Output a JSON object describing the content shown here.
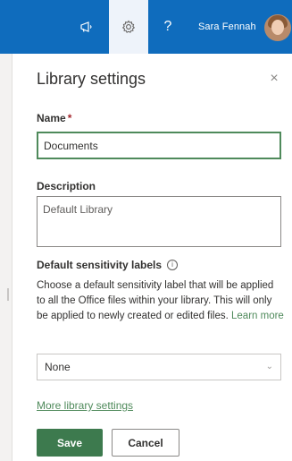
{
  "topbar": {
    "megaphone_icon": "megaphone-icon",
    "gear_icon": "gear-icon",
    "help_glyph": "?",
    "user_name": "Sara Fennah",
    "accent_color": "#0f6cbd"
  },
  "panel": {
    "title": "Library settings",
    "close_glyph": "×",
    "name": {
      "label": "Name",
      "required_mark": "*",
      "value": "Documents"
    },
    "description": {
      "label": "Description",
      "value": "Default Library"
    },
    "sensitivity": {
      "label": "Default sensitivity labels",
      "info_glyph": "i",
      "help_text": "Choose a default sensitivity label that will be applied to all the Office files within your library. This will only be applied to newly created or edited files.",
      "learn_more": "Learn more"
    },
    "dropdown": {
      "selected": "None",
      "chevron": "⌄"
    },
    "more_link": "More library settings",
    "save_label": "Save",
    "cancel_label": "Cancel",
    "primary_color": "#3d7a4e"
  }
}
